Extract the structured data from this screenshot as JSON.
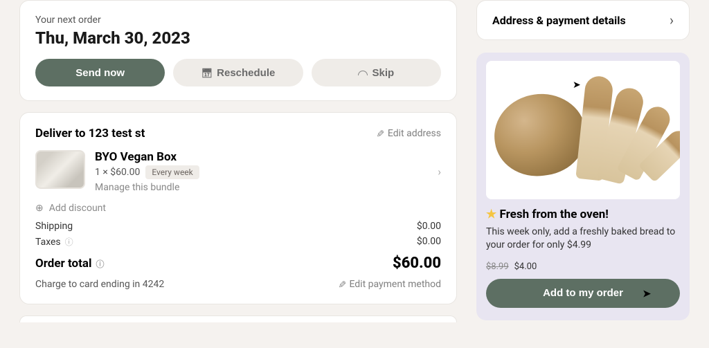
{
  "next_order": {
    "label": "Your next order",
    "date": "Thu, March 30, 2023",
    "buttons": {
      "send_now": "Send now",
      "reschedule": "Reschedule",
      "skip": "Skip"
    }
  },
  "delivery": {
    "title": "Deliver to 123 test st",
    "edit_address": "Edit address",
    "product": {
      "name": "BYO Vegan Box",
      "qty_price": "1 × $60.00",
      "frequency": "Every week",
      "manage": "Manage this bundle"
    },
    "add_discount": "Add discount",
    "shipping": {
      "label": "Shipping",
      "value": "$0.00"
    },
    "taxes": {
      "label": "Taxes",
      "value": "$0.00"
    },
    "order_total": {
      "label": "Order total",
      "value": "$60.00"
    },
    "charge_to": "Charge to card ending in 4242",
    "edit_payment": "Edit payment method"
  },
  "address_payment": {
    "title": "Address & payment details"
  },
  "promo": {
    "title": "Fresh from the oven!",
    "desc": "This week only, add a freshly baked bread to your order for only $4.99",
    "old_price": "$8.99",
    "sale_price": "$4.00",
    "cta": "Add to my order"
  }
}
